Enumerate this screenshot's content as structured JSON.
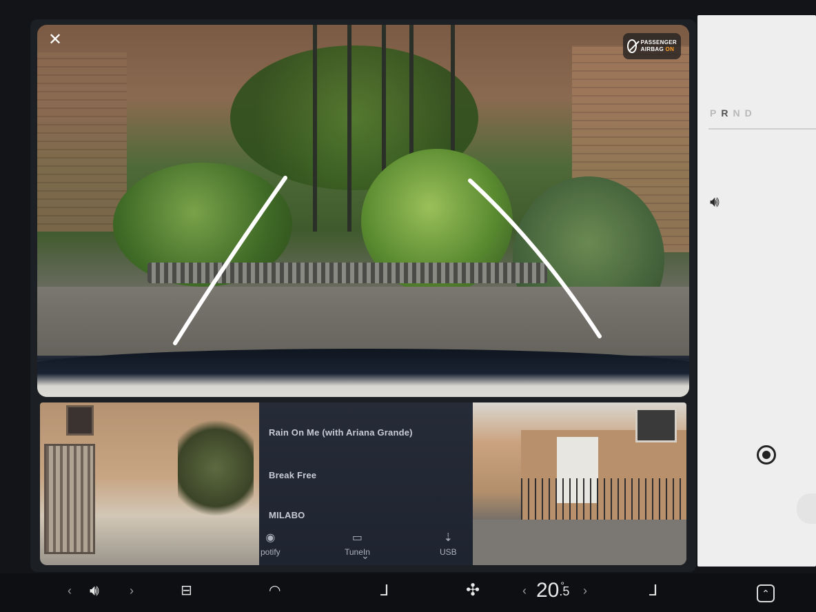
{
  "camera": {
    "close_label": "✕",
    "airbag": {
      "line1": "PASSENGER",
      "line2_prefix": "AIRBAG ",
      "line2_status": "ON",
      "status_color": "#ff9e2a",
      "icon": "airbag-off-icon"
    }
  },
  "media": {
    "tracks": [
      "Rain On Me (with Ariana Grande)",
      "Break Free",
      "MILABO"
    ],
    "sources": [
      {
        "label": "potify",
        "icon": "spotify-icon"
      },
      {
        "label": "TuneIn",
        "icon": "tunein-icon"
      },
      {
        "label": "USB",
        "icon": "usb-icon"
      }
    ]
  },
  "side_panel": {
    "gears": [
      "P",
      "R",
      "N",
      "D"
    ],
    "active_gear": "R"
  },
  "bottom_bar": {
    "temperature_whole": "20",
    "temperature_decimal": ".5",
    "temperature_unit": "°"
  }
}
